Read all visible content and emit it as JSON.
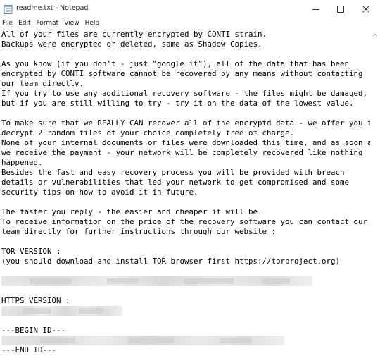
{
  "window": {
    "title": "readme.txt - Notepad",
    "minimize_icon": "minimize-icon",
    "maximize_icon": "maximize-icon",
    "close_icon": "close-icon",
    "app_icon": "notepad-icon"
  },
  "menu": {
    "items": [
      {
        "label": "File"
      },
      {
        "label": "Edit"
      },
      {
        "label": "Format"
      },
      {
        "label": "View"
      },
      {
        "label": "Help"
      }
    ]
  },
  "document": {
    "lines": [
      "All of your files are currently encrypted by CONTI strain.",
      "Backups were encrypted or deleted, same as Shadow Copies.",
      "",
      "As you know (if you don't - just \"google it\"), all of the data that has been",
      "encrypted by CONTI software cannot be recovered by any means without contacting",
      "our team directly.",
      "If you try to use any additional recovery software - the files might be damaged,",
      "but if you are still willing to try - try it on the data of the lowest value.",
      "",
      "To make sure that we REALLY CAN recover all of the encryptd data - we offer you to",
      "decrypt 2 random files of your choice completely free of charge.",
      "None of your internal documents or files were downloaded this time, and as soon as",
      "we receive the payment - your network will be completely recovered like nothing",
      "happened.",
      "Besides the fast and easy recovery process you will be provided with breach",
      "details or vulnerabilities that led your network to get compromised and some",
      "security tips on how to avoid it in future.",
      "",
      "The faster you reply - the easier and cheaper it will be.",
      "To receive information on the price of the recovery software you can contact our",
      "team directly for further instructions through our website :",
      "",
      "TOR VERSION :",
      "(you should download and install TOR browser first https://torproject.org)",
      "",
      "",
      "",
      "HTTPS VERSION :",
      "",
      "",
      "---BEGIN ID---",
      "",
      "---END ID---"
    ]
  }
}
